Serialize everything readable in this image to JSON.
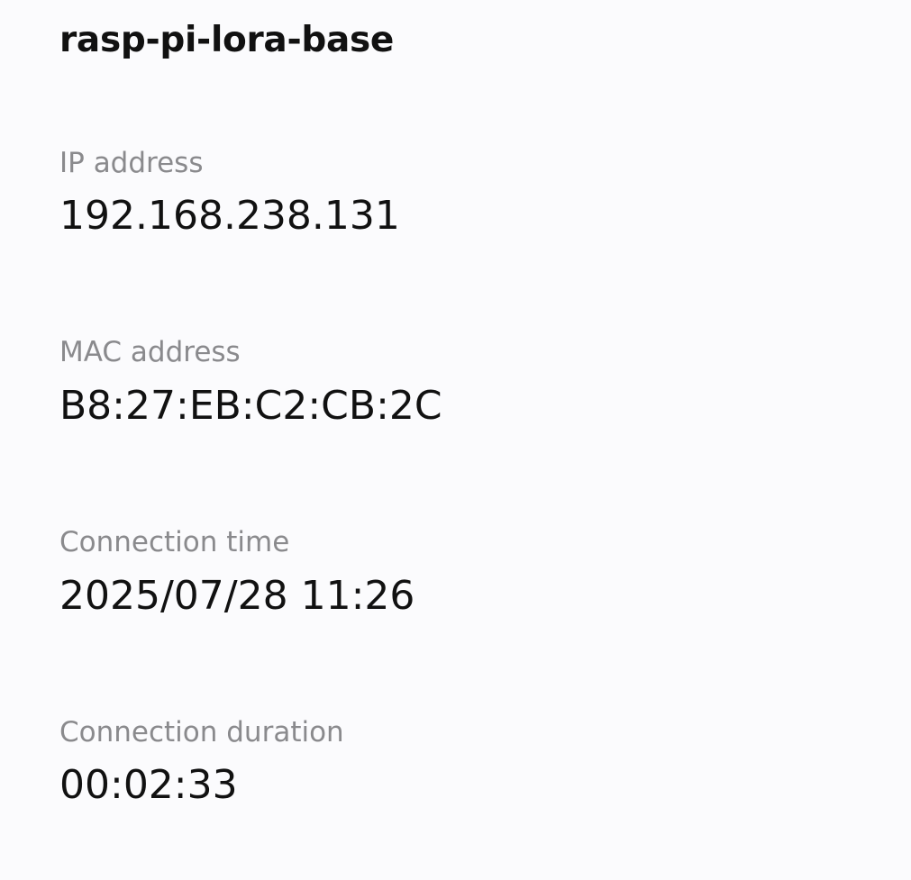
{
  "device": {
    "name": "rasp-pi-lora-base"
  },
  "details": {
    "ip": {
      "label": "IP address",
      "value": "192.168.238.131"
    },
    "mac": {
      "label": "MAC address",
      "value": "B8:27:EB:C2:CB:2C"
    },
    "connection_time": {
      "label": "Connection time",
      "value": "2025/07/28 11:26"
    },
    "connection_duration": {
      "label": "Connection duration",
      "value": "00:02:33"
    }
  },
  "colors": {
    "background": "#fbfbfd",
    "primary_text": "#111111",
    "secondary_text": "#8a8a8d"
  }
}
